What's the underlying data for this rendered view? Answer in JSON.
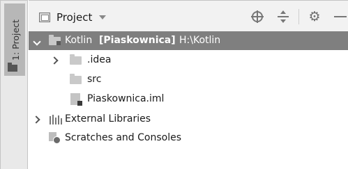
{
  "tool_window": {
    "side_tab_label": "1: Project"
  },
  "header": {
    "title": "Project",
    "icons": [
      "project-view-icon",
      "locate-target-icon",
      "collapse-all-icon",
      "gear-icon",
      "minimize-icon"
    ]
  },
  "tree": {
    "root": {
      "name": "Kotlin",
      "module": "[Piaskownica]",
      "path": "H:\\Kotlin",
      "expanded": true,
      "selected": true
    },
    "children": [
      {
        "name": ".idea",
        "type": "folder",
        "expanded": false
      },
      {
        "name": "src",
        "type": "folder"
      },
      {
        "name": "Piaskownica.iml",
        "type": "iml-file"
      }
    ],
    "external_libraries": "External Libraries",
    "scratches": "Scratches and Consoles"
  },
  "colors": {
    "selection_bg": "#7f7f7f",
    "header_bg": "#f2f2f2",
    "toolstrip_bg": "#e9e9e9"
  }
}
